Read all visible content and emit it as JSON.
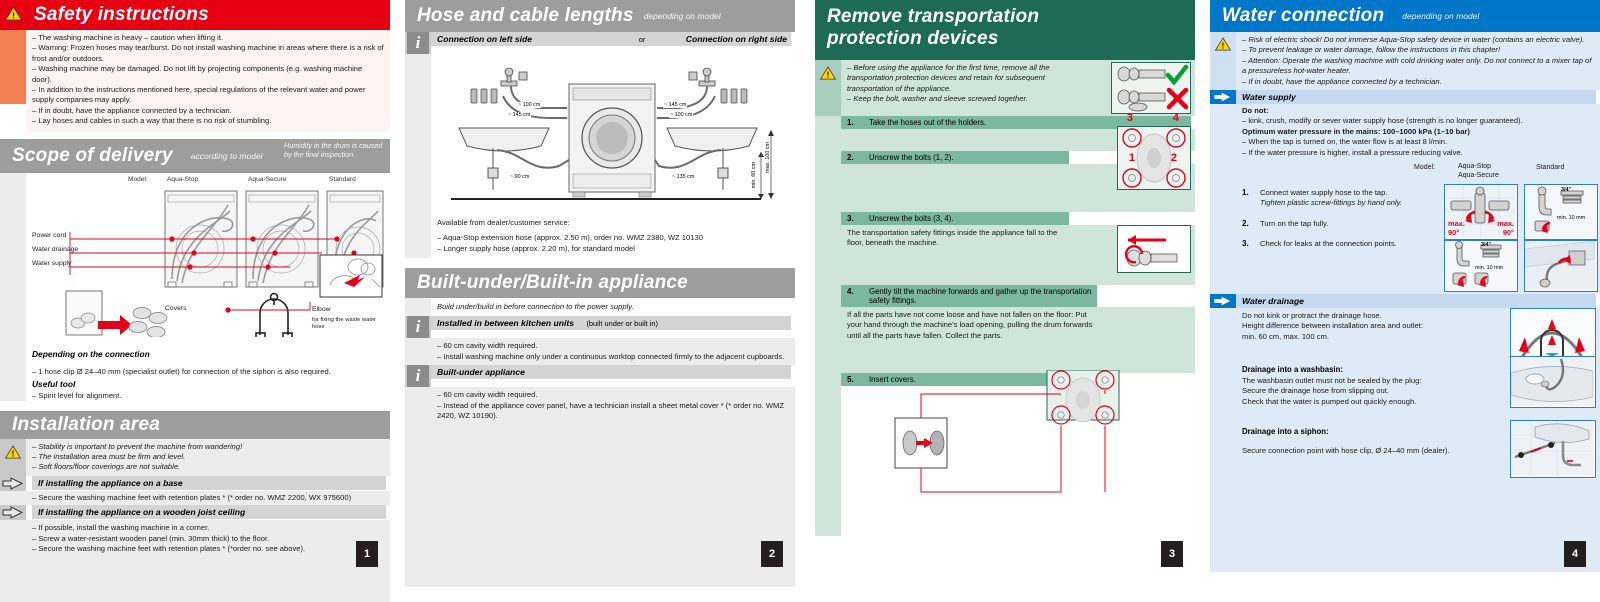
{
  "columns": [
    {
      "page_number": "1",
      "sections": [
        {
          "id": "safety",
          "title": "Safety instructions",
          "subtitle": "",
          "banner_color": "#e60012",
          "items": [
            "– The washing machine is heavy – caution when lifting it.",
            "– Warning: Frozen hoses may tear/burst. Do not install washing machine in areas where there is a risk of frost and/or outdoors.",
            "– Washing machine may be damaged. Do not lift by projecting components (e.g. washing machine door).",
            "– In addition to the instructions mentioned here, special regulations of the relevant water and power supply companies may apply.",
            "– If in doubt, have the appliance connected by a technician.",
            "– Lay hoses and cables in such a way that there is no risk of stumbling."
          ]
        },
        {
          "id": "scope",
          "title": "Scope of delivery",
          "subtitle": "according to model",
          "note": "Humidity in the drum is caused by the final inspection.",
          "diagram": {
            "model_label": "Model:",
            "model_names": [
              "Aqua-Stop",
              "Aqua-Secure",
              "Standard"
            ],
            "callouts": [
              "Power cord",
              "Water drainage",
              "Water supply"
            ],
            "covers_label": "Covers",
            "elbow_label": "Elbow",
            "elbow_sub": "for fixing the waste water hose"
          },
          "dep_title": "Depending on the connection",
          "dep_item": "– 1 hose clip Ø 24–40 mm (specialist outlet) for connection of the siphon is also required.",
          "tool_title": "Useful tool",
          "tool_item": "– Spirit level for alignment."
        },
        {
          "id": "installation",
          "title": "Installation area",
          "warn_items": [
            "– Stability is important to prevent the machine from wandering!",
            "– The installation area must be firm and level.",
            "– Soft floors/floor coverings are not suitable."
          ],
          "base_title": "If installing the appliance on a base",
          "base_items": [
            "– Secure the washing machine feet with retention plates * (* order no. WMZ 2200, WX 975600)"
          ],
          "joist_title": "If installing the appliance on a wooden joist ceiling",
          "joist_items": [
            "– If possible, install the washing machine in a corner.",
            "– Screw a water-resistant wooden panel (min. 30mm thick) to the floor.",
            "– Secure the washing machine feet with retention plates * (*order no. see above)."
          ]
        }
      ]
    },
    {
      "page_number": "2",
      "sections": [
        {
          "id": "hose-lengths",
          "title": "Hose and cable lengths",
          "subtitle": "depending on model",
          "left_label": "Connection on left side",
          "or_label": "or",
          "right_label": "Connection on right side",
          "diagram": {
            "left_top": "~ 100 cm",
            "left_mid": "~ 145 cm",
            "right_top": "~ 145 cm",
            "right_mid": "~ 100 cm",
            "left_bottom": "~ 90 cm",
            "right_bottom": "~ 135 cm",
            "height_min": "min. 60 cm",
            "height_max": "max. 100 cm"
          },
          "avail_title": "Available from dealer/customer service:",
          "avail_items": [
            "– Aqua-Stop extension hose (approx. 2.50 m), order no. WMZ 2380, WZ 10130",
            "– Longer supply hose (approx. 2.20 m), for standard model"
          ]
        },
        {
          "id": "built-under",
          "title": "Built-under/Built-in appliance",
          "intro": "Build under/build in before connection to the power supply.",
          "kitchen_title": "Installed in between kitchen units",
          "kitchen_title_note": "(built under or built in)",
          "kitchen_items": [
            "– 60 cm cavity width required.",
            "– Install washing machine only under a continuous worktop connected firmly to the adjacent cupboards."
          ],
          "builtunder_title": "Built-under appliance",
          "builtunder_items": [
            "– 60 cm cavity width required.",
            "– Instead of the appliance cover panel, have a technician install a sheet metal cover * (* order no. WMZ 2420, WZ 10190)."
          ]
        }
      ]
    },
    {
      "page_number": "3",
      "sections": [
        {
          "id": "transport-protection",
          "title": "Remove transportation protection devices",
          "banner_color": "#1d6b53",
          "warn_items": [
            "– Before using the appliance for the first time, remove all the transportation protection devices and retain for subsequent transportation of the appliance.",
            "– Keep the bolt, washer and sleeve screwed together."
          ],
          "steps": [
            {
              "no": "1.",
              "text": "Take the hoses out of the holders.",
              "detail": ""
            },
            {
              "no": "2.",
              "text": "Unscrew the bolts (1, 2).",
              "detail": ""
            },
            {
              "no": "3.",
              "text": "Unscrew the bolts (3, 4).",
              "detail": "The transportation safety fittings inside the appliance fall to the floor, beneath the machine."
            },
            {
              "no": "4.",
              "text": "Gently tilt the machine forwards and gather up the transportation safety fittings.",
              "detail": "If all the parts have not come loose and have not fallen on the floor: Put your hand through the machine's load opening, pulling the drum forwards until all the parts have fallen. Collect the parts."
            },
            {
              "no": "5.",
              "text": "Insert covers.",
              "detail": ""
            }
          ],
          "bolt_labels": [
            "3",
            "4",
            "1",
            "2"
          ]
        }
      ]
    },
    {
      "page_number": "4",
      "sections": [
        {
          "id": "water-connection",
          "title": "Water connection",
          "subtitle": "depending on model",
          "banner_color": "#0076c8",
          "warn_items": [
            "– Risk of electric shock! Do not immerse Aqua-Stop safety device in water (contains an electric valve).",
            "– To prevent leakage or water damage, follow the instructions in this chapter!",
            "– Attention: Operate the washing machine with cold drinking water only. Do not connect to a mixer tap of a pressureless hot-water heater.",
            "– If in doubt, have the appliance connected by a technician."
          ],
          "supply_title": "Water supply",
          "donot_label": "Do not:",
          "donot_items": [
            "– kink, crush, modify or sever water supply hose (strength is no longer guaranteed)."
          ],
          "pressure_line": "Optimum water pressure in the mains: 100–1000 kPa (1–10 bar)",
          "pressure_items": [
            "– When the tap is turned on, the water flow is at least 8 l/min.",
            "– If the water pressure is higher, install a pressure reducing valve."
          ],
          "model_label": "Model:",
          "model_col1": "Aqua-Stop\nAqua-Secure",
          "model_col2": "Standard",
          "steps": [
            {
              "no": "1.",
              "text": "Connect water supply hose to the tap.",
              "detail": "Tighten plastic screw-fittings by hand only."
            },
            {
              "no": "2.",
              "text": "Turn on the tap fully.",
              "detail": ""
            },
            {
              "no": "3.",
              "text": "Check for leaks at the connection points.",
              "detail": ""
            }
          ],
          "fig_labels": {
            "max_left": "max.",
            "deg_left": "90°",
            "max_right": "max.",
            "deg_right": "90°",
            "thread": "3/4\"",
            "min_mm": "min. 10 mm"
          },
          "drainage_title": "Water drainage",
          "drainage_items": [
            "Do not kink or protract the drainage hose.",
            "Height difference between installation area and outlet:",
            "min. 60 cm, max. 100 cm."
          ],
          "washbasin_title": "Drainage into a washbasin:",
          "washbasin_items": [
            "The washbasin outlet must not be sealed by the plug:",
            "Secure the drainage hose from slipping out.",
            "Check that the water is pumped out quickly enough."
          ],
          "siphon_title": "Drainage into a siphon:",
          "siphon_items": [
            "Secure connection point with hose clip, Ø 24–40 mm (dealer)."
          ]
        }
      ]
    }
  ]
}
